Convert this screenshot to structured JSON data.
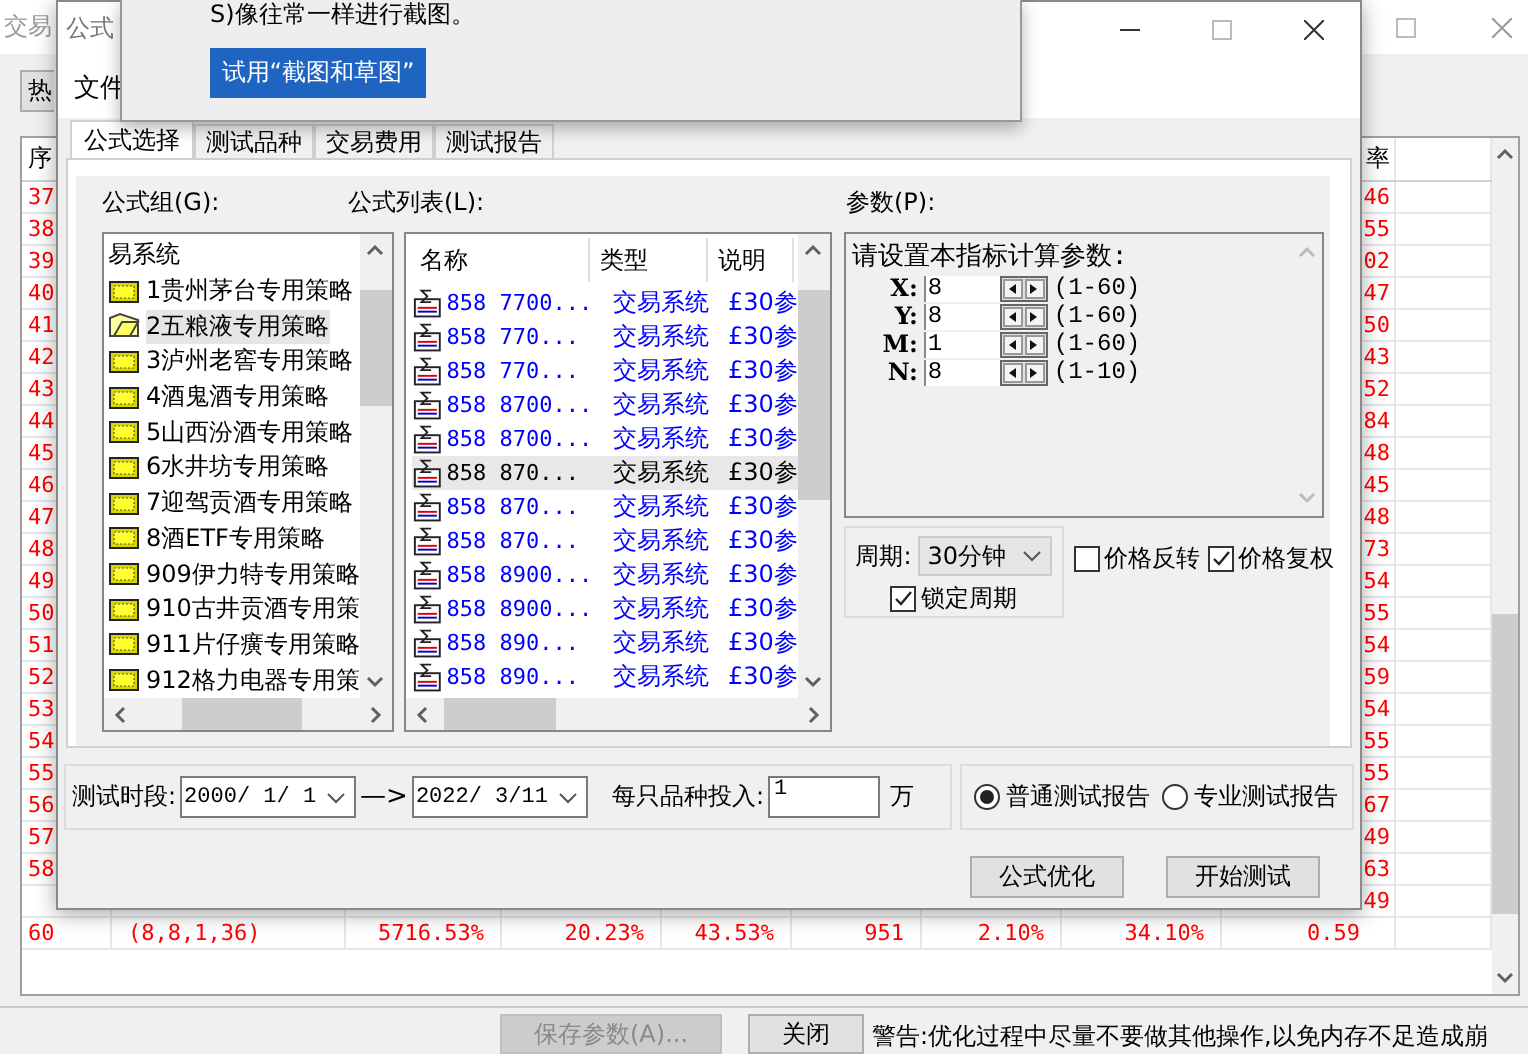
{
  "main_window": {
    "title": "交易",
    "toolbar_button": "热",
    "table": {
      "columns": {
        "first": "序",
        "last": "率"
      },
      "rows": [
        {
          "number": "37",
          "last": "46"
        },
        {
          "number": "38",
          "last": "55"
        },
        {
          "number": "39",
          "last": "02"
        },
        {
          "number": "40",
          "last": "47"
        },
        {
          "number": "41",
          "last": "50"
        },
        {
          "number": "42",
          "last": "43"
        },
        {
          "number": "43",
          "last": "52"
        },
        {
          "number": "44",
          "last": "84"
        },
        {
          "number": "45",
          "last": "48"
        },
        {
          "number": "46",
          "last": "45"
        },
        {
          "number": "47",
          "last": "48"
        },
        {
          "number": "48",
          "last": "73"
        },
        {
          "number": "49",
          "last": "54"
        },
        {
          "number": "50",
          "last": "55"
        },
        {
          "number": "51",
          "last": "54"
        },
        {
          "number": "52",
          "last": "59"
        },
        {
          "number": "53",
          "last": "54"
        },
        {
          "number": "54",
          "last": "55"
        },
        {
          "number": "55",
          "last": "55"
        },
        {
          "number": "56",
          "last": "67"
        },
        {
          "number": "57",
          "last": "49"
        },
        {
          "number": "58",
          "last": "63"
        },
        {
          "last": "49"
        },
        {
          "number": "60",
          "middle": [
            "(8,8,1,36)",
            "5716.53%",
            "20.23%",
            "43.53%",
            "951",
            "2.10%",
            "34.10%"
          ],
          "last": "0.59"
        }
      ]
    },
    "buttons": [
      {
        "label": "保存参数(A)...",
        "disabled": true
      },
      {
        "label": "关闭",
        "disabled": false
      }
    ],
    "warning": "警告:优化过程中尽量不要做其他操作,以免内存不足造成崩"
  },
  "dialog": {
    "title": "公式",
    "menu": [
      "文件"
    ],
    "tabs": [
      {
        "label": "公式选择",
        "selected": true
      },
      {
        "label": "测试品种",
        "selected": false
      },
      {
        "label": "交易费用",
        "selected": false
      },
      {
        "label": "测试报告",
        "selected": false
      }
    ],
    "group_label": "公式组(G):",
    "groups": [
      {
        "label": "易系统",
        "kind": "root",
        "selected": false
      },
      {
        "label": "1贵州茅台专用策略",
        "kind": "folder",
        "selected": false
      },
      {
        "label": "2五粮液专用策略",
        "kind": "folder",
        "selected": true
      },
      {
        "label": "3泸州老窖专用策略",
        "kind": "folder",
        "selected": false
      },
      {
        "label": "4酒鬼酒专用策略",
        "kind": "folder",
        "selected": false
      },
      {
        "label": "5山西汾酒专用策略",
        "kind": "folder",
        "selected": false
      },
      {
        "label": "6水井坊专用策略",
        "kind": "folder",
        "selected": false
      },
      {
        "label": "7迎驾贡酒专用策略",
        "kind": "folder",
        "selected": false
      },
      {
        "label": "8酒ETF专用策略",
        "kind": "folder",
        "selected": false
      },
      {
        "label": "909伊力特专用策略",
        "kind": "folder",
        "selected": false
      },
      {
        "label": "910古井贡酒专用策",
        "kind": "folder",
        "selected": false
      },
      {
        "label": "911片仔癀专用策略",
        "kind": "folder",
        "selected": false
      },
      {
        "label": "912格力电器专用策",
        "kind": "folder",
        "selected": false
      }
    ],
    "formula_label": "公式列表(L):",
    "formula_columns": [
      "名称",
      "类型",
      "说明"
    ],
    "formulas": [
      {
        "name": "858 7700...",
        "type": "交易系统",
        "description": "£30参",
        "selected": false
      },
      {
        "name": "858 770...",
        "type": "交易系统",
        "description": "£30参",
        "selected": false
      },
      {
        "name": "858 770...",
        "type": "交易系统",
        "description": "£30参",
        "selected": false
      },
      {
        "name": "858 8700...",
        "type": "交易系统",
        "description": "£30参",
        "selected": false
      },
      {
        "name": "858 8700...",
        "type": "交易系统",
        "description": "£30参",
        "selected": false
      },
      {
        "name": "858 870...",
        "type": "交易系统",
        "description": "£30参",
        "selected": true
      },
      {
        "name": "858 870...",
        "type": "交易系统",
        "description": "£30参",
        "selected": false
      },
      {
        "name": "858 870...",
        "type": "交易系统",
        "description": "£30参",
        "selected": false
      },
      {
        "name": "858 8900...",
        "type": "交易系统",
        "description": "£30参",
        "selected": false
      },
      {
        "name": "858 8900...",
        "type": "交易系统",
        "description": "£30参",
        "selected": false
      },
      {
        "name": "858 890...",
        "type": "交易系统",
        "description": "£30参",
        "selected": false
      },
      {
        "name": "858 890...",
        "type": "交易系统",
        "description": "£30参",
        "selected": false
      }
    ],
    "params_label": "参数(P):",
    "params_prompt": "请设置本指标计算参数:",
    "params": [
      {
        "name": "X:",
        "value": "8",
        "range": "(1-60)"
      },
      {
        "name": "Y:",
        "value": "8",
        "range": "(1-60)"
      },
      {
        "name": "M:",
        "value": "1",
        "range": "(1-60)"
      },
      {
        "name": "N:",
        "value": "8",
        "range": "(1-10)"
      }
    ],
    "period_label": "周期:",
    "period": "30分钟",
    "lock_period": {
      "label": "锁定周期",
      "checked": true
    },
    "options": [
      {
        "label": "价格反转",
        "checked": false
      },
      {
        "label": "价格复权",
        "checked": true
      }
    ],
    "test_period_label": "测试时段:",
    "start_date": "2000/ 1/ 1",
    "arrow": "—>",
    "end_date": "2022/ 3/11",
    "invest_label": "每只品种投入:",
    "invest_value": "1",
    "invest_unit": "万",
    "report_types": [
      {
        "label": "普通测试报告",
        "selected": true
      },
      {
        "label": "专业测试报告",
        "selected": false
      }
    ],
    "buttons": [
      "公式优化",
      "开始测试"
    ]
  },
  "popup": {
    "text": "S)像往常一样进行截图。",
    "button": "试用“截图和草图”"
  }
}
